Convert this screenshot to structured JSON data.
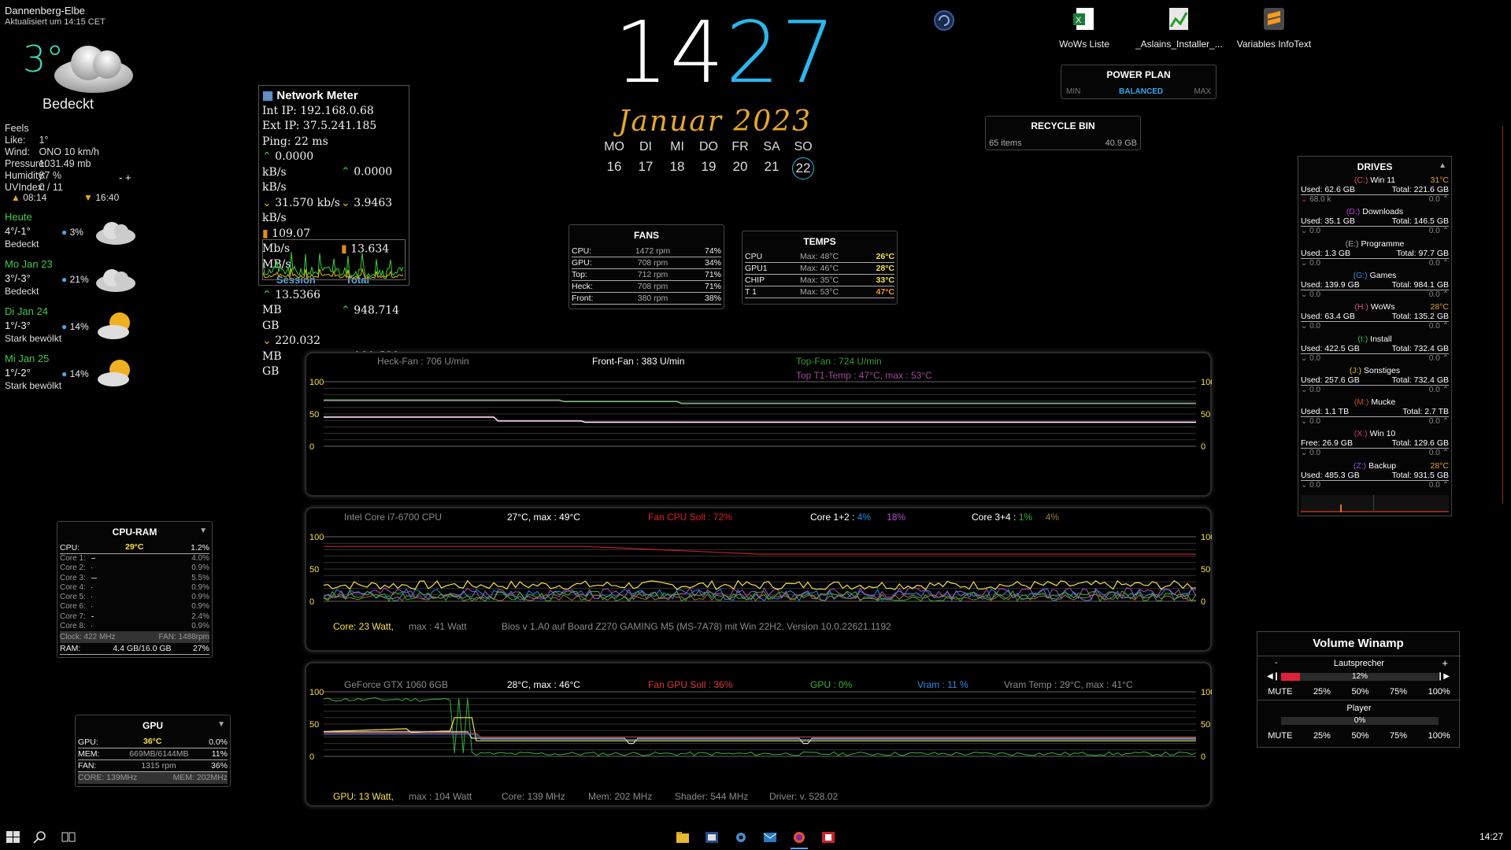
{
  "weather": {
    "location": "Dannenberg-Elbe",
    "updated": "Aktualisiert um 14:15  CET",
    "temp": "3°",
    "condition": "Bedeckt",
    "details": [
      {
        "k": "Feels Like:",
        "v": "1°"
      },
      {
        "k": "Wind:",
        "v": "ONO 10 km/h"
      },
      {
        "k": "Pressure:",
        "v": "1031.49 mb"
      },
      {
        "k": "Humidity:",
        "v": "87 %"
      },
      {
        "k": "UVIndex:",
        "v": "0 / 11"
      }
    ],
    "pm": "-  +",
    "sunrise": "08:14",
    "sunset": "16:40",
    "forecast": [
      {
        "day": "Heute",
        "temp": "4°/-1°",
        "precip": "3%",
        "desc": "Bedeckt",
        "icon": "cloud-icon"
      },
      {
        "day": "Mo Jan 23",
        "temp": "3°/-3°",
        "precip": "21%",
        "desc": "Bedeckt",
        "icon": "cloud-icon"
      },
      {
        "day": "Di Jan 24",
        "temp": "1°/-3°",
        "precip": "14%",
        "desc": "Stark bewölkt",
        "icon": "sun-cloud-icon"
      },
      {
        "day": "Mi Jan 25",
        "temp": "1°/-2°",
        "precip": "14%",
        "desc": "Stark bewölkt",
        "icon": "sun-cloud-icon"
      }
    ]
  },
  "clock": {
    "hours": "14",
    "minutes": "27"
  },
  "calendar": {
    "month": "Januar 2023",
    "days": [
      "MO",
      "DI",
      "MI",
      "DO",
      "FR",
      "SA",
      "SO"
    ],
    "dates": [
      "16",
      "17",
      "18",
      "19",
      "20",
      "21",
      "22"
    ],
    "today_index": 6
  },
  "desktop_icons": [
    {
      "label": "WoWs Liste",
      "icon": "excel-icon"
    },
    {
      "label": "_Aslains_Installer_...",
      "icon": "installer-icon"
    },
    {
      "label": "Variables InfoText",
      "icon": "sublime-icon"
    }
  ],
  "power_plan": {
    "title": "POWER PLAN",
    "min": "MIN",
    "current": "BALANCED",
    "max": "MAX"
  },
  "recycle_bin": {
    "title": "RECYCLE BIN",
    "items": "65 items",
    "size": "40.9 GB"
  },
  "network": {
    "title": "Network Meter",
    "int_ip": "Int IP: 192.168.0.68",
    "ext_ip": "Ext IP: 37.5.241.185",
    "ping": "Ping: 22 ms",
    "rows": [
      {
        "a": "0.0000 kB/s",
        "b": "0.0000 kB/s",
        "type": "up"
      },
      {
        "a": "31.570 kb/s",
        "b": "3.9463 kB/s",
        "type": "down"
      },
      {
        "a": "109.07 Mb/s",
        "b": "13.634 MB/s",
        "type": "bar"
      }
    ],
    "session": "Session",
    "total": "Total",
    "totals": [
      {
        "a": "13.5366 MB",
        "b": "948.714 GB",
        "type": "up"
      },
      {
        "a": "220.032 MB",
        "b": "101.600 GB",
        "type": "down"
      }
    ]
  },
  "fans": {
    "title": "FANS",
    "rows": [
      {
        "name": "CPU:",
        "rpm": "1472 rpm",
        "pct": "74%"
      },
      {
        "name": "GPU:",
        "rpm": "708 rpm",
        "pct": "34%"
      },
      {
        "name": "Top:",
        "rpm": "712 rpm",
        "pct": "71%"
      },
      {
        "name": "Heck:",
        "rpm": "708 rpm",
        "pct": "71%"
      },
      {
        "name": "Front:",
        "rpm": "380 rpm",
        "pct": "38%"
      }
    ]
  },
  "temps": {
    "title": "TEMPS",
    "rows": [
      {
        "name": "CPU",
        "max": "Max: 48°C",
        "cur": "26°C",
        "color": "#f5e04a"
      },
      {
        "name": "GPU1",
        "max": "Max: 46°C",
        "cur": "28°C",
        "color": "#f5e04a"
      },
      {
        "name": "CHIP",
        "max": "Max: 35°C",
        "cur": "33°C",
        "color": "#f5e04a"
      },
      {
        "name": "T 1",
        "max": "Max: 53°C",
        "cur": "47°C",
        "color": "#e89a2a"
      }
    ]
  },
  "graph1": {
    "heck": "Heck-Fan : 706 U/min",
    "front": "Front-Fan : 383 U/min",
    "top": "Top-Fan :  724 U/min",
    "t1": "Top T1-Temp :  47°C,  max : 53°C",
    "ticks": [
      "100",
      "50",
      "0"
    ]
  },
  "graph2": {
    "cpu": "Intel Core i7-6700 CPU",
    "temp": "27°C,   max : 49°C",
    "fan": "Fan CPU Soll : 72%",
    "core12": "Core 1+2 :",
    "core12a": "4%",
    "core12b": "18%",
    "core34": "Core 3+4 :",
    "core34a": "1%",
    "core34b": "4%",
    "power": "Core: 23 Watt,",
    "powermax": "max : 41 Watt",
    "bios": "Bios v 1.A0 auf Board Z270 GAMING M5 (MS-7A78) mit Win 22H2, Version 10.0.22621.1192",
    "ticks": [
      "100",
      "50",
      "0"
    ]
  },
  "graph3": {
    "gpu": "GeForce GTX 1060 6GB",
    "temp": "28°C,   max : 46°C",
    "fan": "Fan GPU Soll : 36%",
    "load": "GPU :  0%",
    "vram": "Vram :  11 %",
    "vramtemp": "Vram Temp : 29°C,   max : 41°C",
    "power": "GPU: 13 Watt,",
    "powermax": "max : 104 Watt",
    "core": "Core: 139 MHz",
    "mem": "Mem: 202 MHz",
    "shader": "Shader: 544 MHz",
    "driver": "Driver: v. 528.02",
    "ticks": [
      "100",
      "50",
      "0"
    ]
  },
  "cpuram": {
    "title": "CPU-RAM",
    "temp": "29°C",
    "cpu_label": "CPU:",
    "cpu_pct": "1.2%",
    "cores": [
      {
        "n": "Core 1:",
        "p": "4.0%"
      },
      {
        "n": "Core 2:",
        "p": "0.9%"
      },
      {
        "n": "Core 3:",
        "p": "5.5%"
      },
      {
        "n": "Core 4:",
        "p": "0.9%"
      },
      {
        "n": "Core 5:",
        "p": "0.9%"
      },
      {
        "n": "Core 6:",
        "p": "0.9%"
      },
      {
        "n": "Core 7:",
        "p": "2.4%"
      },
      {
        "n": "Core 8:",
        "p": "0.9%"
      }
    ],
    "clock": "Clock: 422 MHz",
    "fan": "FAN: 1488rpm",
    "ram_label": "RAM:",
    "ram": "4.4 GB/16.0 GB",
    "ram_pct": "27%"
  },
  "gpu": {
    "title": "GPU",
    "temp": "36°C",
    "gpu_label": "GPU:",
    "gpu_pct": "0.0%",
    "mem_label": "MEM:",
    "mem": "669MB/6144MB",
    "mem_pct": "11%",
    "fan_label": "FAN:",
    "fan": "1315 rpm",
    "fan_pct": "36%",
    "core": "CORE: 139MHz",
    "memclk": "MEM: 202MHz"
  },
  "drives": {
    "title": "DRIVES",
    "list": [
      {
        "letter": "(C:)",
        "name": "Win 11",
        "temp": "31°C",
        "used": "Used: 62.6 GB",
        "total": "Total: 221.6 GB",
        "r": "68.0 k",
        "w": "0.0",
        "color": "#e05050"
      },
      {
        "letter": "(D:)",
        "name": "Downloads",
        "temp": "",
        "used": "Used: 35.1 GB",
        "total": "Total: 146.5 GB",
        "r": "0.0",
        "w": "0.0",
        "color": "#b040d0"
      },
      {
        "letter": "(E:)",
        "name": "Programme",
        "temp": "",
        "used": "Used: 1.3 GB",
        "total": "Total: 97.7 GB",
        "r": "0.0",
        "w": "0.0",
        "color": "#aaaaaa"
      },
      {
        "letter": "(G:)",
        "name": "Games",
        "temp": "",
        "used": "Used: 139.9 GB",
        "total": "Total: 984.1 GB",
        "r": "0.0",
        "w": "0.0",
        "color": "#2a8ae0"
      },
      {
        "letter": "(H:)",
        "name": "WoWs",
        "temp": "28°C",
        "used": "Used: 63.4 GB",
        "total": "Total: 135.2 GB",
        "r": "0.0",
        "w": "0.0",
        "color": "#e05090"
      },
      {
        "letter": "(I:)",
        "name": "Install",
        "temp": "",
        "used": "Used: 422.5 GB",
        "total": "Total: 732.4 GB",
        "r": "0.0",
        "w": "0.0",
        "color": "#3ac040"
      },
      {
        "letter": "(J:)",
        "name": "Sonstiges",
        "temp": "",
        "used": "Used: 257.6 GB",
        "total": "Total: 732.4 GB",
        "r": "0.0",
        "w": "0.0",
        "color": "#e0c020"
      },
      {
        "letter": "(M:)",
        "name": "Mucke",
        "temp": "",
        "used": "Used: 1.1 TB",
        "total": "Total: 2.7 TB",
        "r": "0.0",
        "w": "0.0",
        "color": "#c05020"
      },
      {
        "letter": "(X:)",
        "name": "Win 10",
        "temp": "",
        "used": "Free: 26.9 GB",
        "total": "Total: 129.6 GB",
        "r": "0.0",
        "w": "0.0",
        "color": "#e03070"
      },
      {
        "letter": "(Z:)",
        "name": "Backup",
        "temp": "28°C",
        "used": "Used: 485.3 GB",
        "total": "Total: 931.5 GB",
        "r": "0.0",
        "w": "0.0",
        "color": "#9050e0"
      }
    ]
  },
  "volume": {
    "title": "Volume Winamp",
    "minus": "-",
    "plus": "+",
    "device": "Lautsprecher",
    "device_pct": "12%",
    "device_level": 0.12,
    "player": "Player",
    "player_pct": "0%",
    "player_level": 0,
    "presets": [
      "MUTE",
      "25%",
      "50%",
      "75%",
      "100%"
    ]
  },
  "taskbar": {
    "time": "14:27"
  }
}
